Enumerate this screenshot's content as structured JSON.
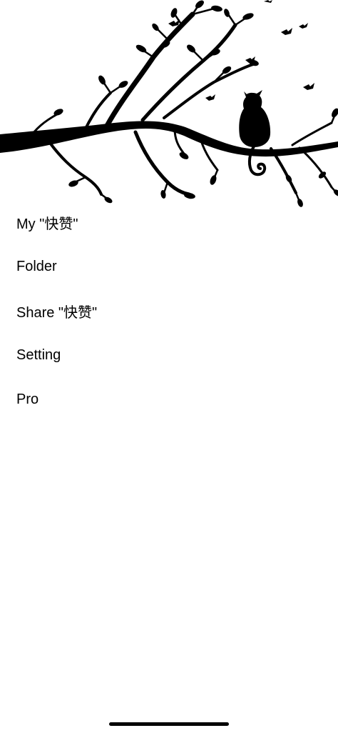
{
  "menu": {
    "items": [
      {
        "label": "My \"快赞\""
      },
      {
        "label": "Folder"
      },
      {
        "label": "Share \"快赞\""
      },
      {
        "label": "Setting"
      },
      {
        "label": "Pro"
      }
    ]
  },
  "colors": {
    "background": "#ffffff",
    "text": "#000000",
    "silhouette": "#000000"
  },
  "icons": {
    "header_art": "tree-branch-cat-silhouette",
    "home_indicator": "home-indicator-bar"
  }
}
